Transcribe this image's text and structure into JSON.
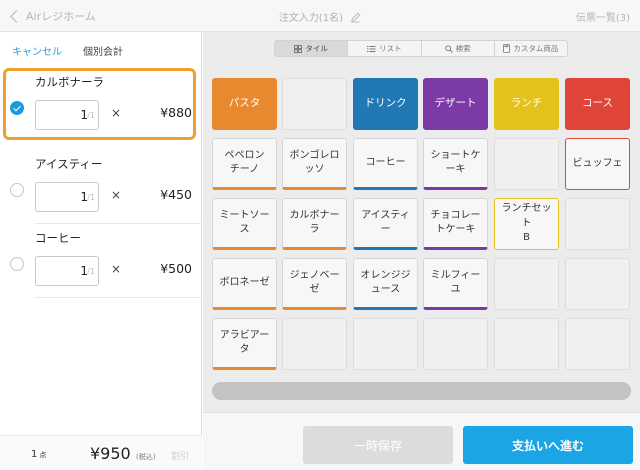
{
  "topbar": {
    "back_label": "Airレジホーム",
    "title": "注文入力(1名)",
    "slip_list": "伝票一覧(3)"
  },
  "actions": {
    "cancel": "キャンセル",
    "split_bill": "個別会計"
  },
  "order_items": [
    {
      "name": "カルボナーラ",
      "qty": "1",
      "max": "/1",
      "times": "×",
      "price": "¥880",
      "selected": true
    },
    {
      "name": "アイスティー",
      "qty": "1",
      "max": "/1",
      "times": "×",
      "price": "¥450",
      "selected": false
    },
    {
      "name": "コーヒー",
      "qty": "1",
      "max": "/1",
      "times": "×",
      "price": "¥500",
      "selected": false
    }
  ],
  "footer": {
    "count": "1",
    "count_unit": "点",
    "total": "¥950",
    "tax": "(税込)",
    "discount": "割引"
  },
  "view_tabs": [
    {
      "label": "タイル",
      "icon": "grid-icon",
      "active": true
    },
    {
      "label": "リスト",
      "icon": "list-icon",
      "active": false
    },
    {
      "label": "検索",
      "icon": "search-icon",
      "active": false
    },
    {
      "label": "カスタム商品",
      "icon": "calculator-icon",
      "active": false
    }
  ],
  "categories": [
    {
      "label": "パスタ",
      "color": "#e8892f"
    },
    {
      "label": "",
      "color": "#f0f0f0"
    },
    {
      "label": "ドリンク",
      "color": "#2277b5"
    },
    {
      "label": "デザート",
      "color": "#7b3aa6"
    },
    {
      "label": "ランチ",
      "color": "#e4c21c"
    },
    {
      "label": "コース",
      "color": "#df4538"
    }
  ],
  "products": [
    [
      "ペペロンチーノ",
      "ボンゴレロッソ",
      "コーヒー",
      "ショートケーキ",
      "",
      "ビュッフェ"
    ],
    [
      "ミートソース",
      "カルボナーラ",
      "アイスティー",
      "チョコレートケーキ",
      "ランチセットB",
      ""
    ],
    [
      "ボロネーゼ",
      "ジェノベーゼ",
      "オレンジジュース",
      "ミルフィーユ",
      "",
      ""
    ],
    [
      "アラビアータ",
      "",
      "",
      "",
      "",
      ""
    ]
  ],
  "product_display": [
    [
      "ペペロン\nチーノ",
      "ボンゴレロ\nッソ",
      "コーヒー",
      "ショートケ\nーキ",
      "",
      "ビュッフェ"
    ],
    [
      "ミートソー\nス",
      "カルボナー\nラ",
      "アイスティ\nー",
      "チョコレー\nトケーキ",
      "ランチセット\nB",
      ""
    ],
    [
      "ボロネーゼ",
      "ジェノベー\nゼ",
      "オレンジジ\nュース",
      "ミルフィー\nユ",
      "",
      ""
    ],
    [
      "アラビアー\nタ",
      "",
      "",
      "",
      "",
      ""
    ]
  ],
  "bottom": {
    "hold": "一時保存",
    "pay": "支払いへ進む"
  }
}
